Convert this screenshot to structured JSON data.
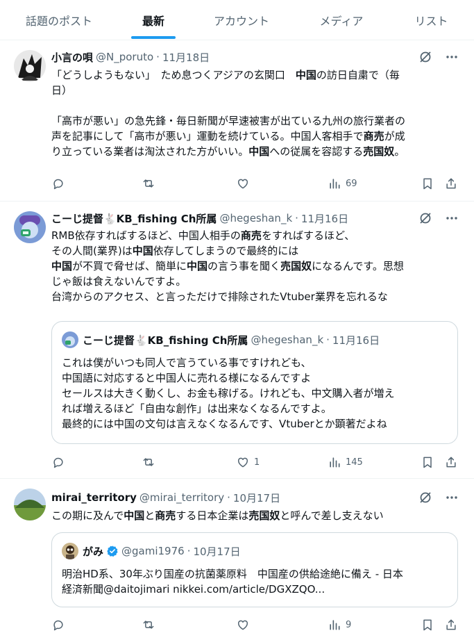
{
  "tabs": [
    {
      "label": "話題のポスト"
    },
    {
      "label": "最新"
    },
    {
      "label": "アカウント"
    },
    {
      "label": "メディア"
    },
    {
      "label": "リスト"
    }
  ],
  "active_tab": "最新",
  "colors": {
    "accent": "#1d9bf0",
    "text": "#0f1419",
    "muted": "#536471",
    "border": "#eff3f4",
    "verified": "#1d9bf0"
  },
  "posts": [
    {
      "name": "小言の唄",
      "handle": "@N_poruto",
      "dot": "·",
      "date": "11月18日",
      "lines": [
        [
          "「どうしようもない」　ため息つくアジアの玄関口　",
          {
            "b": "中国"
          },
          "の訪日自粛で（毎"
        ],
        [
          "日）"
        ],
        [
          ""
        ],
        [
          "「高市が悪い」の急先鋒・毎日新聞が早速被害が出ている九州の旅行業者の"
        ],
        [
          "声を記事にして「高市が悪い」運動を続けている。中国人客相手で",
          {
            "b": "商売"
          },
          "が成"
        ],
        [
          "り立っている業者は淘汰された方がいい。",
          {
            "b": "中国"
          },
          "への従属を容認する",
          {
            "b": "売国奴"
          },
          "。"
        ]
      ],
      "actions": {
        "reply": "",
        "retweet": "",
        "like": "",
        "views": "69"
      }
    },
    {
      "name": "こーじ提督🐇KB_fishing Ch所属",
      "handle": "@hegeshan_k",
      "dot": "·",
      "date": "11月16日",
      "lines": [
        [
          "RMB依存すればするほど、中国人相手の",
          {
            "b": "商売"
          },
          "をすればするほど、"
        ],
        [
          "その人間(業界)は",
          {
            "b": "中国"
          },
          "依存してしまうので最終的には"
        ],
        [
          {
            "b": "中国"
          },
          "が不買で脅せば、簡単に",
          {
            "b": "中国"
          },
          "の言う事を聞く",
          {
            "b": "売国奴"
          },
          "になるんです。思想"
        ],
        [
          "じゃ飯は食えないんですよ。"
        ],
        [
          "台湾からのアクセス、と言っただけで排除されたVtuber業界を忘れるな"
        ]
      ],
      "quote": {
        "name": "こーじ提督🐇KB_fishing Ch所属",
        "handle": "@hegeshan_k",
        "dot": "·",
        "date": "11月16日",
        "lines": [
          "これは僕がいつも同人で言うている事ですけれども、",
          "中国語に対応すると中国人に売れる様になるんですよ",
          "セールスは大きく動くし、お金も稼げる。けれども、中文購入者が増え",
          "れば増えるほど「自由な創作」は出来なくなるんですよ。",
          "最終的には中国の文句は言えなくなるんです、Vtuberとか顕著だよね"
        ]
      },
      "actions": {
        "reply": "",
        "retweet": "",
        "like": "1",
        "views": "145"
      }
    },
    {
      "name": "mirai_territory",
      "handle": "@mirai_territory",
      "dot": "·",
      "date": "10月17日",
      "lines": [
        [
          "この期に及んで",
          {
            "b": "中国"
          },
          "と",
          {
            "b": "商売"
          },
          "する日本企業は",
          {
            "b": "売国奴"
          },
          "と呼んで差し支えない"
        ]
      ],
      "quote": {
        "name": "がみ",
        "verified": true,
        "handle": "@gami1976",
        "dot": "·",
        "date": "10月17日",
        "lines": [
          "明治HD系、30年ぶり国産の抗菌薬原料　中国産の供給途絶に備え - 日本",
          "経済新聞@daitojimari  nikkei.com/article/DGXZQO..."
        ]
      },
      "actions": {
        "reply": "",
        "retweet": "",
        "like": "",
        "views": "9"
      }
    }
  ]
}
